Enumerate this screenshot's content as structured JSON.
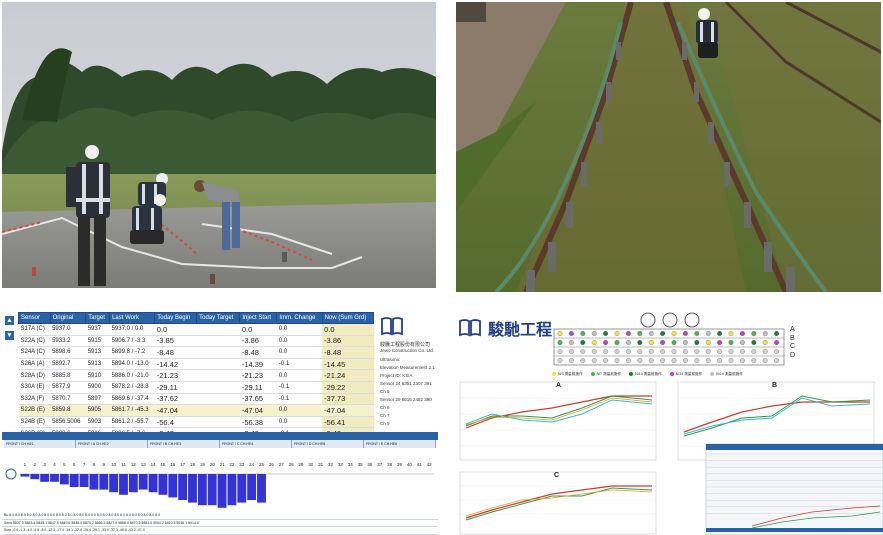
{
  "screen1": {
    "headers": [
      "Sensor",
      "Original",
      "Target",
      "Last Work",
      "Today Begin",
      "Today Target",
      "Inject Start",
      "Imm. Change",
      "Now (Sum Grd)"
    ],
    "rows": [
      [
        "S17A (C)",
        "5937.0",
        "5937",
        "5937.0 / 0.0",
        "0.0",
        "",
        "0.0",
        "0.0",
        "0.0"
      ],
      [
        "S22A (C)",
        "5933.2",
        "5915",
        "5906.7 / -3.3",
        "-3.85",
        "",
        "-3.86",
        "0.0",
        "-3.86"
      ],
      [
        "S24A (C)",
        "5898.6",
        "5913",
        "5899.8 / -7.2",
        "-8.48",
        "",
        "-8.48",
        "0.0",
        "-8.48"
      ],
      [
        "S26A (A)",
        "5892.7",
        "5913",
        "5894.0 / -13.0",
        "-14.42",
        "",
        "-14.39",
        "-0.1",
        "-14.45"
      ],
      [
        "S28A (D)",
        "5885.8",
        "5910",
        "5886.0 / -21.0",
        "-21.23",
        "",
        "-21.23",
        "0.0",
        "-21.24"
      ],
      [
        "S30A (E)",
        "5877.9",
        "5900",
        "5878.2 / -28.8",
        "-29.11",
        "",
        "-29.11",
        "-0.1",
        "-29.22"
      ],
      [
        "S32A (F)",
        "5870.7",
        "5897",
        "5869.6 / -37.4",
        "-37.62",
        "",
        "-37.65",
        "-0.1",
        "-37.73"
      ],
      [
        "S22B (E)",
        "5859.8",
        "5905",
        "5861.7 / -45.3",
        "-47.04",
        "",
        "-47.04",
        "0.0",
        "-47.04"
      ],
      [
        "S24B (E)",
        "5856.5006",
        "5903",
        "5861.2 / -55.7",
        "-56.4",
        "",
        "-56.38",
        "0.0",
        "-56.41"
      ],
      [
        "S26B (C)",
        "5898.6",
        "5916",
        "5896.5 / -7.6",
        "-8.42",
        "",
        "-8.43",
        "-0.1",
        "-8.49"
      ]
    ],
    "company_cn": "駿騰工程股份有限公司",
    "company_en": "Jewo Construction Co. Ltd.",
    "side_lines": [
      "Ultrasonic",
      "Elevation Measurement 2.1",
      "Project ID: KSIA",
      "Sensor 24 6351 2307 391",
      "Ch 5",
      "Sensor 29 6616 2482 390",
      "Ch 6",
      "Ch 7",
      "Ch 5"
    ],
    "strip_labels": [
      "FRONT / CH.HE1",
      "FRONT / A CH.HE2",
      "FRONT / B CH.HE3",
      "FRONT / C CH.HE4",
      "FRONT / D CH.HE5",
      "FRONT / E CH.HE6"
    ],
    "bar_labels": [
      "1",
      "2",
      "3",
      "4",
      "5",
      "6",
      "7",
      "8",
      "9",
      "10",
      "11",
      "12",
      "13",
      "14",
      "15",
      "16",
      "17",
      "18",
      "19",
      "20",
      "21",
      "22",
      "23",
      "24",
      "25",
      "26",
      "27",
      "28",
      "29",
      "30",
      "31",
      "32",
      "33",
      "34",
      "35",
      "36",
      "37",
      "38",
      "39",
      "40",
      "41",
      "42"
    ],
    "bar_values": [
      -1,
      -2,
      -3,
      -3,
      -4,
      -5,
      -5,
      -6,
      -6,
      -7,
      -8,
      -7,
      -6,
      -7,
      -8,
      -9,
      -10,
      -11,
      -12,
      -12,
      -13,
      -12,
      -11,
      -10,
      -11,
      0,
      0,
      0,
      0,
      0,
      0,
      0,
      0,
      0,
      0,
      0,
      0,
      0,
      0,
      0,
      0,
      0
    ],
    "bottom_rows": [
      "Bu 8.0  8.0  8.0  8.0  8.0  8.0  8.0  8.0  8.0  8.0  8.0  8.0  8.0  8.0  8.0  8.0  8.0  8.0  8.0  8.0  8.0  8.0  8.0  8.0  8.0  8.0",
      "Sens 5837.0 5853.4 5845.1 5847.9 5849.6 5838.0 5875.2 5866.5 5827.9 5866.4 5870.3 5881.0 5904.2 5910.3 5936.1 5914.0",
      "Sum -0.0 -1.3 -4.2 -5.5 -8.0 -12.3 -17.0 -19.1 -22.6 -26.4 -29.1 -33.0 -37.3 -40.6 -43.2 -47.0"
    ],
    "colors": {
      "header": "#2a62a8",
      "bar": "#3434d6",
      "highlight": "#f1ecc0"
    }
  },
  "screen2": {
    "title": "駿馳工程",
    "track_letters": [
      "A",
      "B",
      "C",
      "D"
    ],
    "legend": [
      {
        "label": "N/3 測量前施作",
        "color": "#f3e23c"
      },
      {
        "label": "N/7 測量前施作",
        "color": "#4fb04f"
      },
      {
        "label": "N/10 測量前施作",
        "color": "#1f7a3a"
      },
      {
        "label": "N/14 測量前施作",
        "color": "#c23cc2"
      },
      {
        "label": "N/19 測量前施作",
        "color": "#bdbdbd"
      }
    ],
    "charts": [
      {
        "label": "A"
      },
      {
        "label": "B"
      },
      {
        "label": "C"
      }
    ],
    "series_colors": [
      "#d23b2b",
      "#2a9d4a",
      "#39b7d6",
      "#e0a020"
    ]
  }
}
